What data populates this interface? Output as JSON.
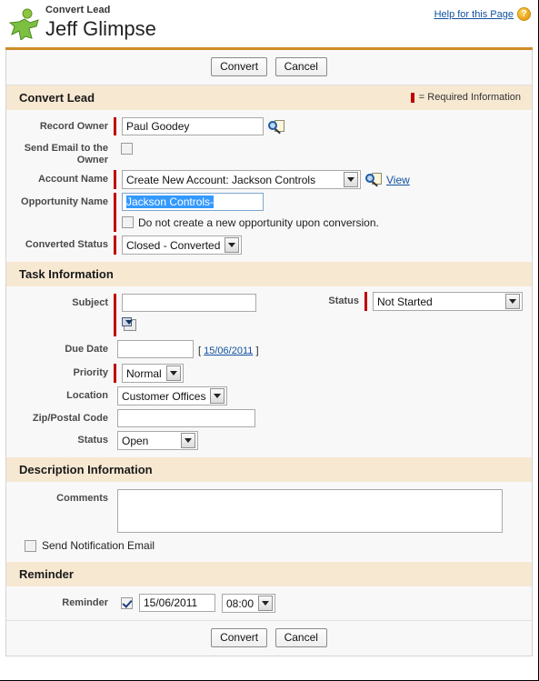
{
  "header": {
    "icon": "lead-person-icon",
    "subtitle": "Convert Lead",
    "title": "Jeff Glimpse",
    "help_label": "Help for this Page",
    "help_icon": "question-mark-icon"
  },
  "buttons": {
    "convert": "Convert",
    "cancel": "Cancel"
  },
  "sections": {
    "convert_lead": {
      "title": "Convert Lead",
      "required_note": "= Required Information",
      "fields": {
        "record_owner_label": "Record Owner",
        "record_owner_value": "Paul Goodey",
        "send_email_label": "Send Email to the Owner",
        "send_email_checked": false,
        "account_name_label": "Account Name",
        "account_name_value": "Create New Account: Jackson Controls",
        "account_view_link": "View",
        "opportunity_name_label": "Opportunity Name",
        "opportunity_name_value": "Jackson Controls-",
        "no_opportunity_label": "Do not create a new opportunity upon conversion.",
        "no_opportunity_checked": false,
        "converted_status_label": "Converted Status",
        "converted_status_value": "Closed - Converted"
      }
    },
    "task_information": {
      "title": "Task Information",
      "fields": {
        "subject_label": "Subject",
        "subject_value": "",
        "status_label": "Status",
        "status_value": "Not Started",
        "due_date_label": "Due Date",
        "due_date_value": "",
        "due_date_hint_open": "[",
        "due_date_hint_link": "15/06/2011",
        "due_date_hint_close": "]",
        "priority_label": "Priority",
        "priority_value": "Normal",
        "location_label": "Location",
        "location_value": "Customer Offices",
        "zip_label": "Zip/Postal Code",
        "zip_value": "",
        "status2_label": "Status",
        "status2_value": "Open"
      }
    },
    "description_information": {
      "title": "Description Information",
      "fields": {
        "comments_label": "Comments",
        "comments_value": "",
        "send_notification_label": "Send Notification Email",
        "send_notification_checked": false
      }
    },
    "reminder": {
      "title": "Reminder",
      "fields": {
        "reminder_label": "Reminder",
        "reminder_checked": true,
        "reminder_date": "15/06/2011",
        "reminder_time": "08:00"
      }
    }
  },
  "colors": {
    "section_header_bg": "#f7e8d2",
    "required_marker": "#c00000",
    "orange_rule": "#cf8d28",
    "link": "#11519e",
    "selection_highlight": "#3399ff"
  }
}
